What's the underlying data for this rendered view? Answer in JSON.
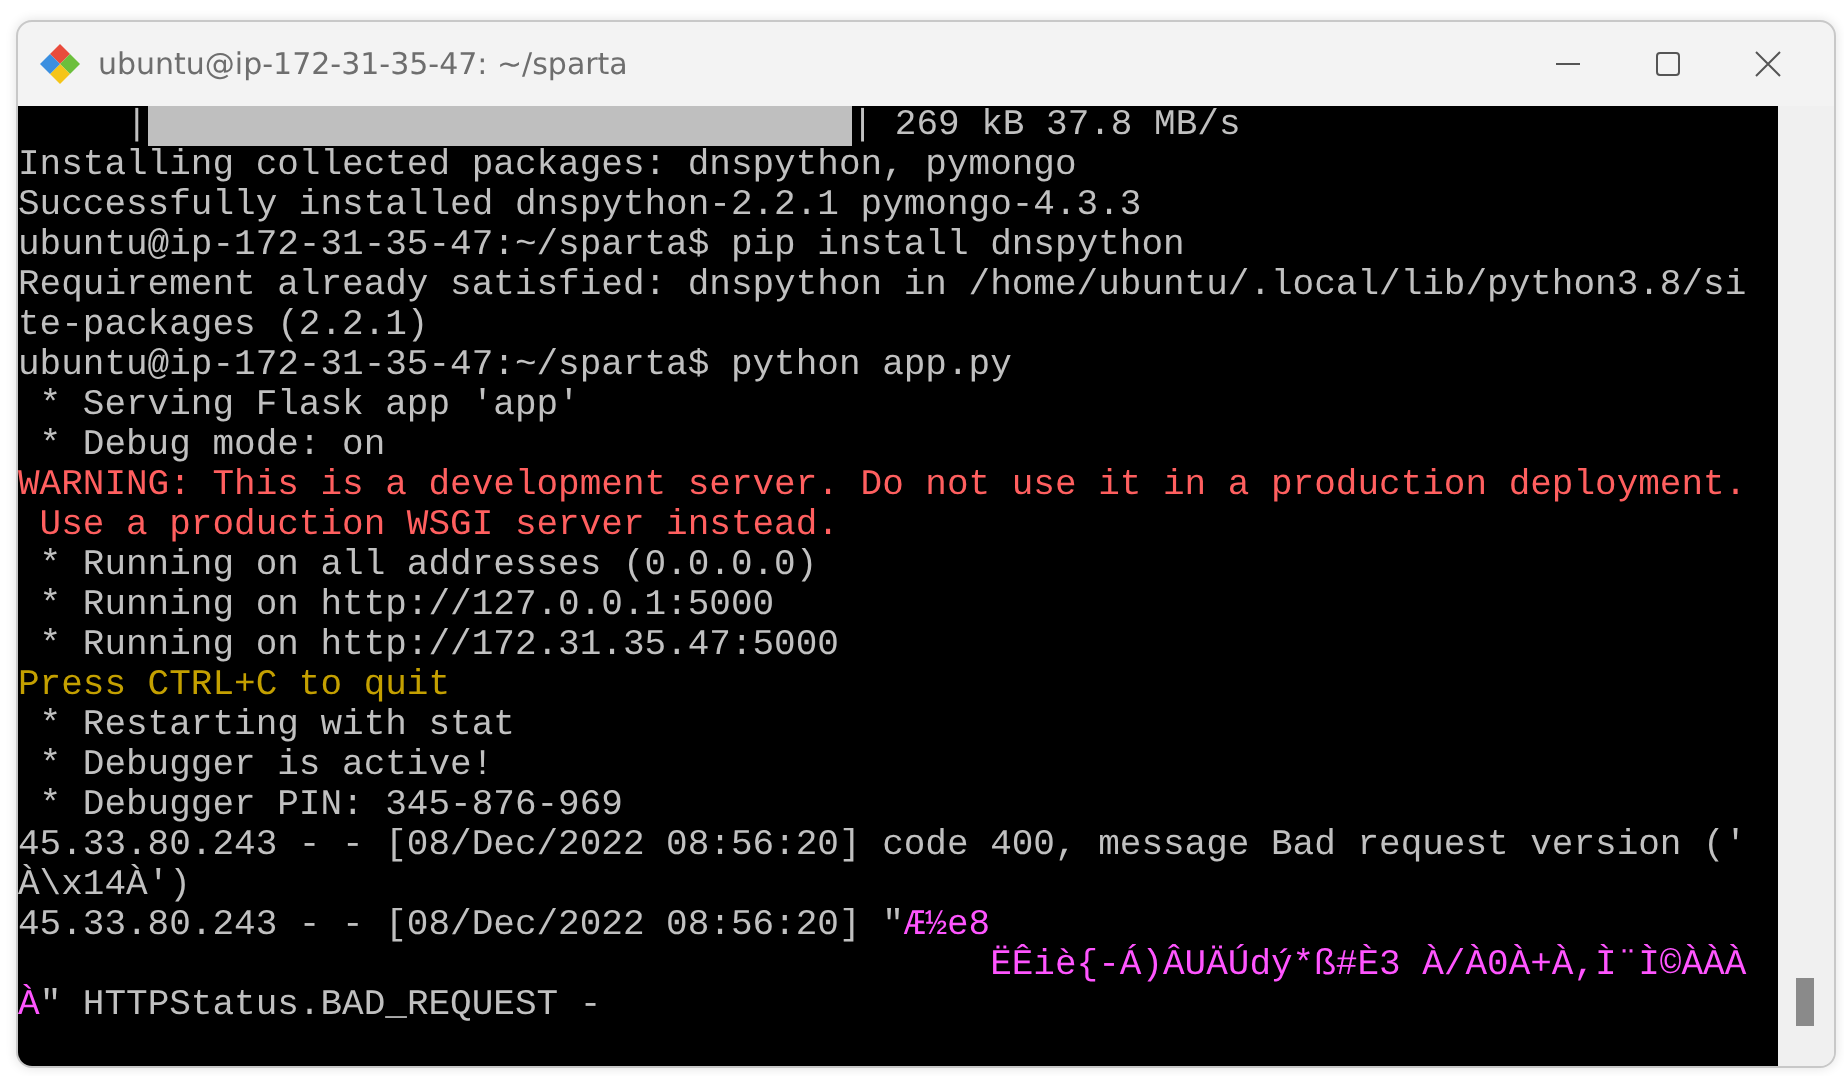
{
  "window": {
    "title": "ubuntu@ip-172-31-35-47: ~/sparta"
  },
  "terminal": {
    "lines": [
      [
        {
          "kind": "plain",
          "text": "     |"
        },
        {
          "kind": "bar",
          "level": 1
        },
        {
          "kind": "plain",
          "text": "| 269 kB 37.8 MB/s"
        }
      ],
      [
        {
          "kind": "plain",
          "text": "Installing collected packages: dnspython, pymongo"
        }
      ],
      [
        {
          "kind": "plain",
          "text": "Successfully installed dnspython-2.2.1 pymongo-4.3.3"
        }
      ],
      [
        {
          "kind": "plain",
          "text": "ubuntu@ip-172-31-35-47:~/sparta$ pip install dnspython"
        }
      ],
      [
        {
          "kind": "plain",
          "text": "Requirement already satisfied: dnspython in /home/ubuntu/.local/lib/python3.8/si"
        }
      ],
      [
        {
          "kind": "plain",
          "text": "te-packages (2.2.1)"
        }
      ],
      [
        {
          "kind": "plain",
          "text": "ubuntu@ip-172-31-35-47:~/sparta$ python app.py"
        }
      ],
      [
        {
          "kind": "plain",
          "text": " * Serving Flask app 'app'"
        }
      ],
      [
        {
          "kind": "plain",
          "text": " * Debug mode: on"
        }
      ],
      [
        {
          "kind": "error",
          "text": "WARNING: This is a development server. Do not use it in a production deployment."
        }
      ],
      [
        {
          "kind": "error",
          "text": " Use a production WSGI server instead."
        }
      ],
      [
        {
          "kind": "plain",
          "text": " * Running on all addresses (0.0.0.0)"
        }
      ],
      [
        {
          "kind": "plain",
          "text": " * Running on http://127.0.0.1:5000"
        }
      ],
      [
        {
          "kind": "plain",
          "text": " * Running on http://172.31.35.47:5000"
        }
      ],
      [
        {
          "kind": "warning",
          "text": "Press CTRL+C to quit"
        }
      ],
      [
        {
          "kind": "plain",
          "text": " * Restarting with stat"
        }
      ],
      [
        {
          "kind": "plain",
          "text": " * Debugger is active!"
        }
      ],
      [
        {
          "kind": "plain",
          "text": " * Debugger PIN: 345-876-969"
        }
      ],
      [
        {
          "kind": "plain",
          "text": "45.33.80.243 - - [08/Dec/2022 08:56:20] code 400, message Bad request version ('"
        }
      ],
      [
        {
          "kind": "plain",
          "text": "À\\x14À')"
        }
      ],
      [
        {
          "kind": "plain",
          "text": "45.33.80.243 - - [08/Dec/2022 08:56:20] \""
        },
        {
          "kind": "binary",
          "text": "Æ½e8"
        }
      ],
      [
        {
          "kind": "binary",
          "text": "                                             ËÊiè{-Á)ÂUÄÚdý*ß#È3 À/À0À+À,Ì¨Ì©ÀÀÀ"
        }
      ],
      [
        {
          "kind": "binary",
          "text": "À"
        },
        {
          "kind": "plain",
          "text": "\" HTTPStatus.BAD_REQUEST -"
        }
      ]
    ]
  }
}
